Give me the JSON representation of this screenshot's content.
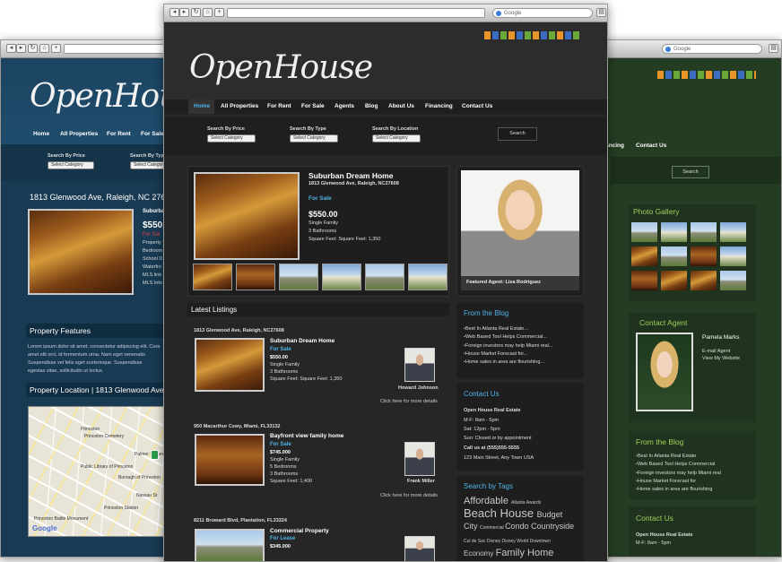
{
  "browser": {
    "search_placeholder": "Google"
  },
  "colors": {
    "blue_theme_bg": "#183a52",
    "dark_theme_bg": "#262626",
    "green_theme_bg": "#243c22",
    "accent_blue": "#4fb3e6",
    "accent_red": "#e04040",
    "accent_green": "#9fd05a"
  },
  "brand": {
    "logo": "OpenHouse",
    "logo_split_1": "Open",
    "logo_split_2": "House"
  },
  "left_window": {
    "nav": [
      "Home",
      "All Properties",
      "For Rent",
      "For Sale"
    ],
    "search": [
      {
        "label": "Search By Price",
        "value": "Select Category"
      },
      {
        "label": "Search By Type",
        "value": "Select Category"
      }
    ],
    "address_title": "1813 Glenwood Ave, Raleigh, NC 276",
    "detail": {
      "name": "Suburba",
      "price": "$550.",
      "status": "For Sal",
      "lines": [
        "Property",
        "Bedroom",
        "School D",
        "Waterfro",
        "MLS link",
        "MLS Info"
      ]
    },
    "features_title": "Property Features",
    "features_text": "Lorem ipsum dolor sit amet, consectetur adipiscing elit. Curabitur amet elit orci, id fermentum urna. Nam eget venenatis. Foreign egestas vel felis eget scelerisque. Suspendisse egestas vitae, sollicitudin ut lectus.",
    "features_lines": [
      "Lorem ipsum dolor sit amet, consectetur adipiscing elit. Cura",
      "amet elit orci, id fermentum urna. Nam eget venenatis",
      "Suspendisse vel felis eget scelerisque. Suspendisse",
      "egestas vitae, sollicitudin ut lectus."
    ],
    "location_title": "Property Location | 1813 Glenwood Ave",
    "map_labels": [
      "Princeton",
      "Princeton Cemetery",
      "Palmer Square",
      "Borough of Princeton",
      "Public Library of Princeton",
      "Princeton Battle Monument",
      "Princeton Station",
      "Nassau St",
      "Google"
    ]
  },
  "center_window": {
    "nav": [
      "Home",
      "All Properties",
      "For Rent",
      "For Sale",
      "Agents",
      "Blog",
      "About Us",
      "Financing",
      "Contact Us"
    ],
    "search": [
      {
        "label": "Search By Price",
        "value": "Select Category"
      },
      {
        "label": "Search By Type",
        "value": "Select Category"
      },
      {
        "label": "Search By Location",
        "value": "Select Category"
      }
    ],
    "search_button": "Search",
    "featured": {
      "title": "Suburban Dream Home",
      "address": "1813 Glenwood Ave, Raleigh, NC27608",
      "status": "For Sale",
      "price": "$550.00",
      "type": "Single Family",
      "bathrooms": "3  Bathrooms",
      "sqft": "Square Feet: Square Feet: 1,350"
    },
    "featured_agent": "Featured Agent: Lisa Rodriguez",
    "latest_title": "Latest Listings",
    "listings": [
      {
        "address": "1813 Glenwood Ave, Raleigh, NC27608",
        "title": "Suburban Dream Home",
        "status": "For Sale",
        "price": "$550.00",
        "type": "Single Family",
        "rooms": "3  Bathrooms",
        "sqft": "Square Feet: Square Feet: 1,350",
        "agent": "Howard Johnson",
        "more": "Click here for more details"
      },
      {
        "address": "950 Macarthur Cswy, Miami, FL33132",
        "title": "Bayfront view family home",
        "status": "For Sale",
        "price": "$745.000",
        "type": "Single Family",
        "rooms": "5  Bedrooms",
        "rooms2": "3  Bathrooms",
        "sqft": "Square Feet: 1,400",
        "agent": "Frank Miller",
        "more": "Click here for more details"
      },
      {
        "address": "8211 Broward Blvd, Plantation, FL33324",
        "title": "Commercial Property",
        "status": "For Lease",
        "price": "$345.000"
      }
    ],
    "blog_title": "From the Blog",
    "blog_items": [
      "Best In Atlanta Real Estate...",
      "Web Based Tool Helps Commercial...",
      "Foreign investors may help Miami real...",
      "House Market Forecast for...",
      "Home sales in area are flourishing..."
    ],
    "contact_title": "Contact Us",
    "contact": [
      "Open House Real Estate",
      "M-F: 8am - 5pm",
      "Sat: 12pm - 5pm",
      "Sun: Closed or by appointment",
      "Call us at (555)555-5555",
      "123 Main Street, Any Town USA"
    ],
    "tags_title": "Search by Tags",
    "tags": [
      [
        {
          "t": "Affordable",
          "s": 11
        },
        {
          "t": "Atlanta Awards",
          "s": 5
        }
      ],
      [
        {
          "t": "Beach House",
          "s": 13
        },
        {
          "t": "Budget",
          "s": 9
        }
      ],
      [
        {
          "t": "City",
          "s": 9
        },
        {
          "t": "Commercial",
          "s": 5
        },
        {
          "t": "Condo",
          "s": 9
        },
        {
          "t": "Countryside",
          "s": 9
        }
      ],
      [
        {
          "t": "Cul de Sac",
          "s": 5
        },
        {
          "t": "Disney",
          "s": 5
        },
        {
          "t": "Disney World",
          "s": 5
        },
        {
          "t": "Downtown",
          "s": 5
        }
      ],
      [
        {
          "t": "Economy",
          "s": 8
        },
        {
          "t": "Family Home",
          "s": 11
        }
      ]
    ]
  },
  "right_window": {
    "nav": [
      "ancing",
      "Contact Us"
    ],
    "search_button": "Search",
    "gallery_title": "Photo Gallery",
    "contact_agent_title": "Contact Agent",
    "agent": {
      "name": "Pamela Marks",
      "email": "E-mail Agent",
      "site": "View My Website"
    },
    "blog_title": "From the Blog",
    "blog_items": [
      "Best In Atlanta Real Estate",
      "Web Based Tool Helps Commercial",
      "Foreign investors may help Miami real",
      "House Market Forecast for",
      "Home sales in area are flourishing"
    ],
    "contact_title": "Contact Us",
    "contact": [
      "Open House Real Estate",
      "M-F: 8am - 5pm"
    ]
  }
}
